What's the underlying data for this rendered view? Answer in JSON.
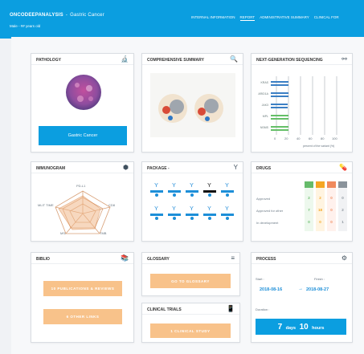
{
  "header": {
    "brand": "ONCODEEPANALYSIS",
    "separator": "-",
    "cancer": "Gastric Cancer",
    "patient": "Male - ## years old",
    "nav": [
      "INTERNAL INFORMATION",
      "REPORT",
      "ADMINISTRATIVE SUMMARY",
      "CLINICAL FOR"
    ]
  },
  "pathology": {
    "title": "PATHOLOGY",
    "button": "Gastric Cancer"
  },
  "summary": {
    "title": "COMPREHENSIVE SUMMARY"
  },
  "ngs": {
    "title": "NEXT-GENERATION SEQUENCING",
    "genes": [
      "KRAS",
      "ARID1A",
      "JAK3",
      "MPL",
      "NSMS"
    ],
    "axis_ticks": [
      "0",
      "20",
      "40",
      "60",
      "80",
      "100"
    ],
    "axis_label": "percent of the variant (%)",
    "colors": {
      "blue": "#3b7fc4",
      "green": "#65bf68"
    }
  },
  "immunogram": {
    "title": "IMMUNOGRAM",
    "axes": [
      "PD-L1",
      "CD8",
      "TMB",
      "MSI",
      "MLIT TIME"
    ]
  },
  "package": {
    "title": "PACKAGE -"
  },
  "drugs": {
    "title": "DRUGS",
    "rows": [
      "Approved",
      "Approved for other",
      "In development"
    ],
    "columns": [
      {
        "color": "#66bb6a",
        "values": [
          "2",
          "7",
          "0"
        ]
      },
      {
        "color": "#f5a623",
        "values": [
          "2",
          "18",
          "0"
        ]
      },
      {
        "color": "#f08a5d",
        "values": [
          "0",
          "0",
          "0"
        ]
      },
      {
        "color": "#8a939b",
        "values": [
          "0",
          "2",
          "1"
        ]
      }
    ]
  },
  "biblio": {
    "title": "BIBLIO",
    "btn1": "10 PUBLICATIONS & REVIEWS",
    "btn2": "6 OTHER LINKS"
  },
  "glossary": {
    "title": "GLOSSARY",
    "btn": "GO TO GLOSSARY"
  },
  "trials": {
    "title": "CLINICAL TRIALS",
    "btn": "1 CLINICAL STUDY"
  },
  "process": {
    "title": "PROCESS",
    "start_label": "Start :",
    "finish_label": "Finish :",
    "start": "2018-08-16",
    "finish": "2018-08-27",
    "duration_label": "Duration :",
    "days": "7",
    "days_label": "days",
    "hours": "10",
    "hours_label": "hours"
  }
}
